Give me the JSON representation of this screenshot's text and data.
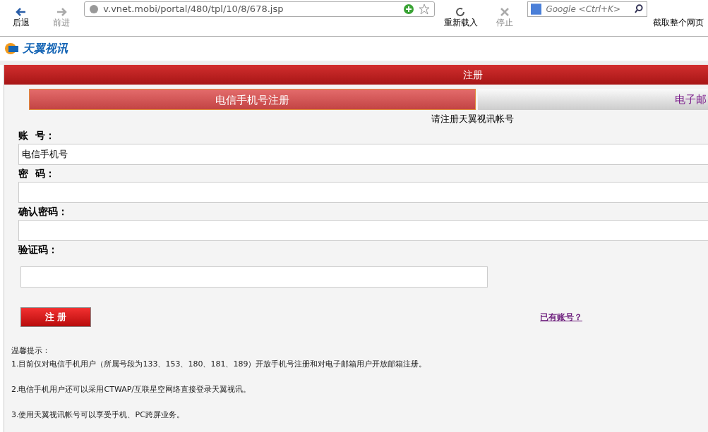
{
  "browser": {
    "back": "后退",
    "forward": "前进",
    "url": "v.vnet.mobi/portal/480/tpl/10/8/678.jsp",
    "reload": "重新载入",
    "stop": "停止",
    "search_placeholder": "Google <Ctrl+K>",
    "capture": "截取整个网页"
  },
  "logo": "天翼视讯",
  "header": {
    "title": "注册"
  },
  "tabs": [
    {
      "label": "电信手机号注册",
      "selected": true
    },
    {
      "label": "电子邮",
      "selected": false
    }
  ],
  "subtitle": "请注册天翼视讯帐号",
  "fields": [
    {
      "label": "账  号：",
      "value": "电信手机号",
      "kind": "wide"
    },
    {
      "label": "密  码：",
      "kind": "wide"
    },
    {
      "label": "确认密码：",
      "kind": "wide"
    },
    {
      "label": "验证码：",
      "kind": "short"
    }
  ],
  "submit": "注 册",
  "login_link": "已有账号？",
  "tips": {
    "title": "温馨提示：",
    "items": [
      "1.目前仅对电信手机用户（所属号段为133、153、180、181、189）开放手机号注册和对电子邮箱用户开放邮箱注册。",
      "2.电信手机用户还可以采用CTWAP/互联星空网络直接登录天翼视讯。",
      "3.使用天翼视讯帐号可以享受手机、PC跨屏业务。"
    ]
  }
}
